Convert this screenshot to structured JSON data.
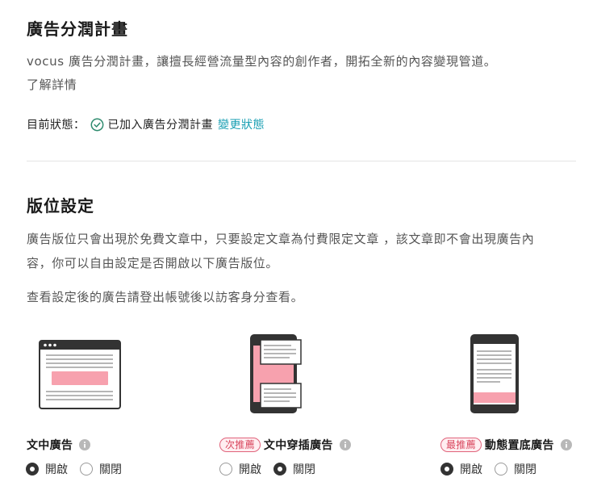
{
  "revenue_share": {
    "title": "廣告分潤計畫",
    "description": "vocus 廣告分潤計畫，讓擅長經營流量型內容的創作者，開拓全新的內容變現管道。",
    "learn_more": "了解詳情",
    "status_label": "目前狀態：",
    "status_value": "已加入廣告分潤計畫",
    "change_status": "變更狀態"
  },
  "placement": {
    "title": "版位設定",
    "description_line1": "廣告版位只會出現於免費文章中，只要設定文章為付費限定文章 ，該文章即不會出現廣告內",
    "description_line2": "容，你可以自由設定是否開啟以下廣告版位。",
    "note": "查看設定後的廣告請登出帳號後以訪客身分查看。"
  },
  "ads": [
    {
      "label": "文中廣告",
      "badge": "",
      "on_label": "開啟",
      "off_label": "關閉",
      "selected": "on"
    },
    {
      "label": "文中穿插廣告",
      "badge": "次推薦",
      "on_label": "開啟",
      "off_label": "關閉",
      "selected": "off"
    },
    {
      "label": "動態置底廣告",
      "badge": "最推薦",
      "on_label": "開啟",
      "off_label": "關閉",
      "selected": "on"
    }
  ],
  "colors": {
    "accent_link": "#1a9fb3",
    "ad_pink": "#f7a1ae",
    "badge_red": "#d9485f",
    "dark": "#333333"
  }
}
